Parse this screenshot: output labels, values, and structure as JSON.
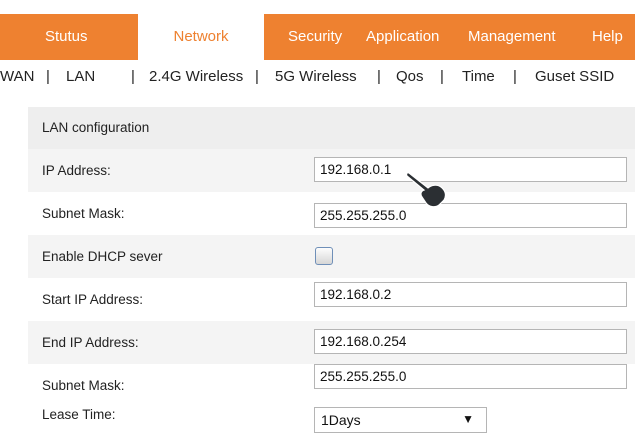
{
  "top_nav": {
    "tabs": [
      {
        "label": "Stutus",
        "active": false
      },
      {
        "label": "Network",
        "active": true
      },
      {
        "label": "Security",
        "active": false
      },
      {
        "label": "Application",
        "active": false
      },
      {
        "label": "Management",
        "active": false
      },
      {
        "label": "Help",
        "active": false
      }
    ]
  },
  "sub_nav": {
    "separator": "|",
    "items": [
      "WAN",
      "LAN",
      "2.4G Wireless",
      "5G Wireless",
      "Qos",
      "Time",
      "Guset SSID"
    ]
  },
  "section": {
    "title": "LAN configuration"
  },
  "form": {
    "ip_address": {
      "label": "IP Address:",
      "value": "192.168.0.1"
    },
    "subnet_mask": {
      "label": "Subnet Mask:",
      "value": "255.255.255.0"
    },
    "enable_dhcp": {
      "label": "Enable DHCP sever",
      "checked": false
    },
    "start_ip": {
      "label": "Start IP Address:",
      "value": "192.168.0.2"
    },
    "end_ip": {
      "label": "End IP Address:",
      "value": "192.168.0.254"
    },
    "dhcp_subnet_mask": {
      "label": "Subnet Mask:",
      "value": "255.255.255.0"
    },
    "lease_time": {
      "label": "Lease Time:",
      "selected": "1Days",
      "arrow": "▼"
    }
  },
  "colors": {
    "accent": "#ee8130",
    "row_shade": "#f4f4f4",
    "header_shade": "#eeeeee"
  },
  "pointer": {
    "icon": "hand-pointer-icon"
  }
}
